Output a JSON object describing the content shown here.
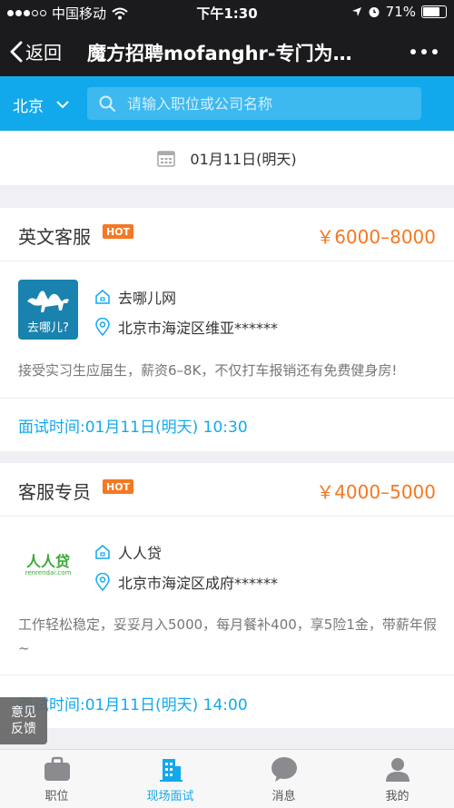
{
  "status_bar": {
    "carrier": "中国移动",
    "time": "下午1:30",
    "battery": "71%"
  },
  "nav": {
    "back_label": "返回",
    "title": "魔方招聘mofanghr-专门为…"
  },
  "search": {
    "city": "北京",
    "placeholder": "请输入职位或公司名称"
  },
  "date": {
    "label": "01月11日(明天)"
  },
  "jobs": [
    {
      "title": "英文客服",
      "hot": "HOT",
      "salary": "￥6000–8000",
      "company": "去哪儿网",
      "address": "北京市海淀区维亚******",
      "description": "接受实习生应届生，薪资6–8K，不仅打车报销还有免费健身房!",
      "interview": "面试时间:01月11日(明天) 10:30",
      "logo_text": "去哪儿?"
    },
    {
      "title": "客服专员",
      "hot": "HOT",
      "salary": "￥4000–5000",
      "company": "人人贷",
      "address": "北京市海淀区成府******",
      "description": "工作轻松稳定，妥妥月入5000，每月餐补400，享5险1金，带薪年假~",
      "interview": "面试时间:01月11日(明天) 14:00",
      "logo_text": "人人贷",
      "logo_subtext": "renrendai.com"
    }
  ],
  "feedback": {
    "line1": "意见",
    "line2": "反馈"
  },
  "tabs": [
    {
      "label": "职位",
      "icon": "briefcase-icon"
    },
    {
      "label": "现场面试",
      "icon": "building-icon",
      "active": true
    },
    {
      "label": "消息",
      "icon": "message-icon"
    },
    {
      "label": "我的",
      "icon": "user-icon"
    }
  ],
  "colors": {
    "accent": "#12a9ec",
    "salary": "#f57822",
    "dark_bar": "#1b1b1d"
  }
}
